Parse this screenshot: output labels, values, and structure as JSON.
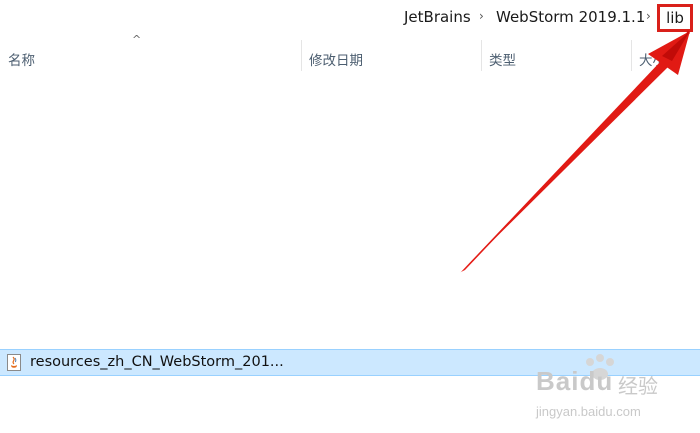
{
  "breadcrumb": {
    "items": [
      "JetBrains",
      "WebStorm 2019.1.1",
      "lib"
    ],
    "separator": "›"
  },
  "columns": {
    "name": "名称",
    "date": "修改日期",
    "type": "类型",
    "size": "大小"
  },
  "files": [
    {
      "name": "resources_zh_CN_WebStorm_201...",
      "selected": true,
      "icon": "jar-file-icon"
    }
  ],
  "watermark": {
    "brand": "Baidu",
    "label": "经验",
    "url": "jingyan.baidu.com"
  },
  "annotation": {
    "color": "#d9201a",
    "highlight": "lib"
  }
}
